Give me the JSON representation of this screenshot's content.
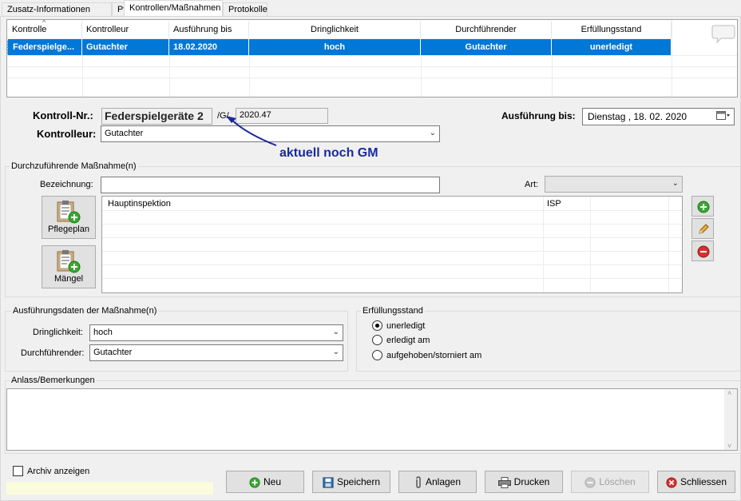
{
  "tabs": [
    {
      "label": "Zusatz-Informationen"
    },
    {
      "label": "Pflege"
    },
    {
      "label": "Kontrollen/Maßnahmen"
    },
    {
      "label": "Protokolle"
    }
  ],
  "grid": {
    "headers": [
      "Kontrolle",
      "Kontrolleur",
      "Ausführung bis",
      "Dringlichkeit",
      "Durchführender",
      "Erfüllungsstand"
    ],
    "selected_row": [
      "Federspielge...",
      "Gutachter",
      "18.02.2020",
      "hoch",
      "Gutachter",
      "unerledigt"
    ]
  },
  "form": {
    "kontroll_nr_label": "Kontroll-Nr.:",
    "kontroll_nr_value": "Federspielgeräte 2",
    "separator": "/G/",
    "nr_suffix": "2020.47",
    "ausfuehrung_label": "Ausführung bis:",
    "ausfuehrung_value": "Dienstag  , 18. 02. 2020",
    "kontrolleur_label": "Kontrolleur:",
    "kontrolleur_value": "Gutachter",
    "annotation": "aktuell noch GM"
  },
  "massnahme": {
    "group_title": "Durchzuführende Maßnahme(n)",
    "bezeichnung_label": "Bezeichnung:",
    "bezeichnung_value": "",
    "art_label": "Art:",
    "art_value": "",
    "pflegeplan_label": "Pflegeplan",
    "maengel_label": "Mängel",
    "list_rows": [
      {
        "name": "Hauptinspektion",
        "art": "ISP"
      }
    ]
  },
  "ausfuehrungsdaten": {
    "group_title": "Ausführungsdaten der Maßnahme(n)",
    "dringlichkeit_label": "Dringlichkeit:",
    "dringlichkeit_value": "hoch",
    "durchfuehrender_label": "Durchführender:",
    "durchfuehrender_value": "Gutachter"
  },
  "erfuellungsstand": {
    "group_title": "Erfüllungsstand",
    "options": [
      {
        "label": "unerledigt",
        "selected": true
      },
      {
        "label": "erledigt am",
        "selected": false
      },
      {
        "label": "aufgehoben/storniert am",
        "selected": false
      }
    ]
  },
  "bemerkungen": {
    "label": "Anlass/Bemerkungen",
    "value": ""
  },
  "footer": {
    "archiv_label": "Archiv anzeigen",
    "archiv_checked": false,
    "buttons": {
      "neu": "Neu",
      "speichern": "Speichern",
      "anlagen": "Anlagen",
      "drucken": "Drucken",
      "loeschen": "Löschen",
      "schliessen": "Schliessen"
    }
  },
  "colors": {
    "selection": "#0078d7",
    "annotation": "#1a2a9c",
    "accent_green": "#3aa832",
    "accent_red": "#d9302c"
  }
}
